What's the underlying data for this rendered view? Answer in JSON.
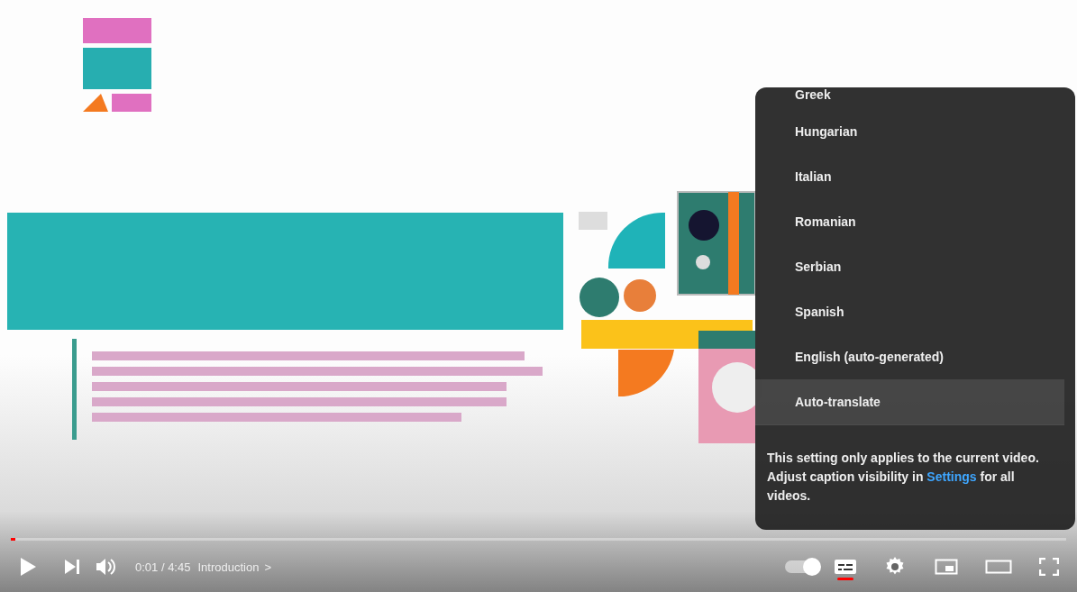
{
  "player": {
    "progress": {
      "level": 0.004
    },
    "time": "0:01 / 4:45",
    "chapter": "Introduction",
    "chapter_arrow": ">",
    "autoplay": {
      "on": true
    },
    "subtitles": {
      "on": true
    }
  },
  "caption_menu": {
    "items": [
      {
        "label": "Greek",
        "highlighted": false
      },
      {
        "label": "Hungarian",
        "highlighted": false
      },
      {
        "label": "Italian",
        "highlighted": false
      },
      {
        "label": "Romanian",
        "highlighted": false
      },
      {
        "label": "Serbian",
        "highlighted": false
      },
      {
        "label": "Spanish",
        "highlighted": false
      },
      {
        "label": "English (auto-generated)",
        "highlighted": false
      },
      {
        "label": "Auto-translate",
        "highlighted": true
      }
    ],
    "note": "This setting only applies to the current video. Adjust caption visibility in",
    "note_link": "Settings",
    "note_end": "for all videos."
  }
}
